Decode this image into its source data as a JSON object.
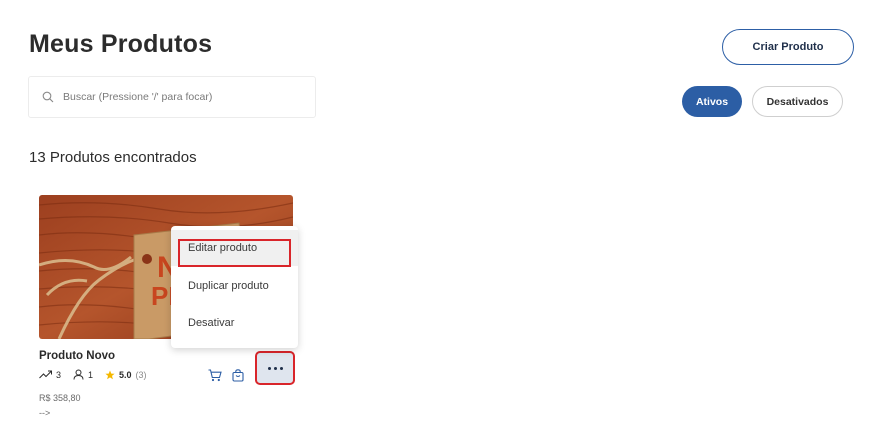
{
  "header": {
    "title": "Meus Produtos",
    "create_label": "Criar Produto"
  },
  "search": {
    "placeholder": "Buscar (Pressione '/' para focar)"
  },
  "filters": {
    "active_label": "Ativos",
    "inactive_label": "Desativados",
    "accent": "#2c5ea5"
  },
  "results": {
    "count_text": "13 Produtos encontrados"
  },
  "product": {
    "name": "Produto Novo",
    "sales": "3",
    "customers": "1",
    "rating": "5.0",
    "rating_count": "(3)",
    "price": "R$ 358,80",
    "trailing_text": "-->",
    "image_tag_text": "NO PRO"
  },
  "menu": {
    "items": [
      {
        "label": "Editar produto"
      },
      {
        "label": "Duplicar produto"
      },
      {
        "label": "Desativar"
      }
    ]
  },
  "colors": {
    "highlight_border": "#d9252a",
    "star": "#f5b800"
  }
}
